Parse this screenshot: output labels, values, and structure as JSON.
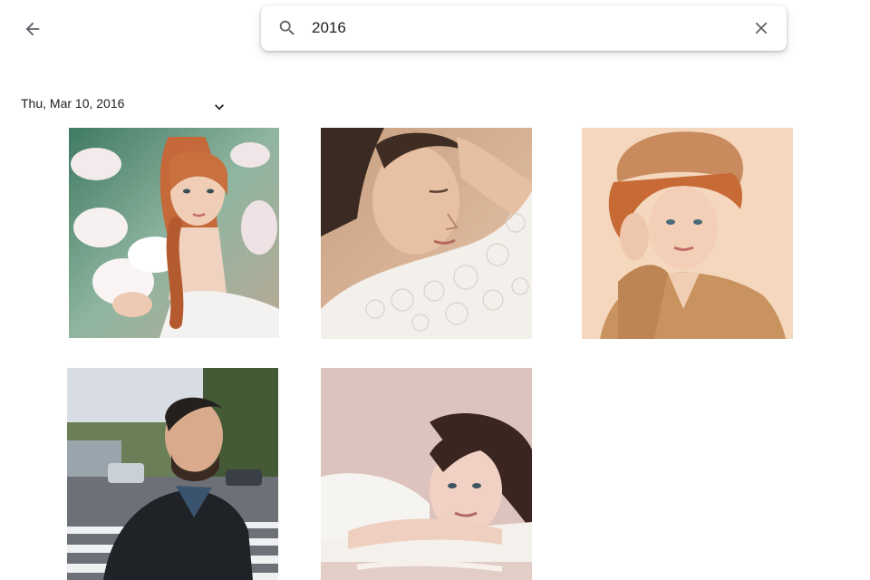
{
  "header": {
    "back_icon": "arrow-back-icon",
    "search": {
      "value": "2016",
      "search_icon": "search-icon",
      "clear_icon": "close-icon"
    }
  },
  "group": {
    "date_label": "Thu, Mar 10, 2016",
    "toggle_icon": "chevron-down-icon",
    "photos": [
      {
        "id": "photo-1"
      },
      {
        "id": "photo-2"
      },
      {
        "id": "photo-3"
      },
      {
        "id": "photo-4"
      },
      {
        "id": "photo-5"
      }
    ]
  },
  "colors": {
    "icon": "#5f6368",
    "text": "#202124",
    "background": "#ffffff"
  }
}
